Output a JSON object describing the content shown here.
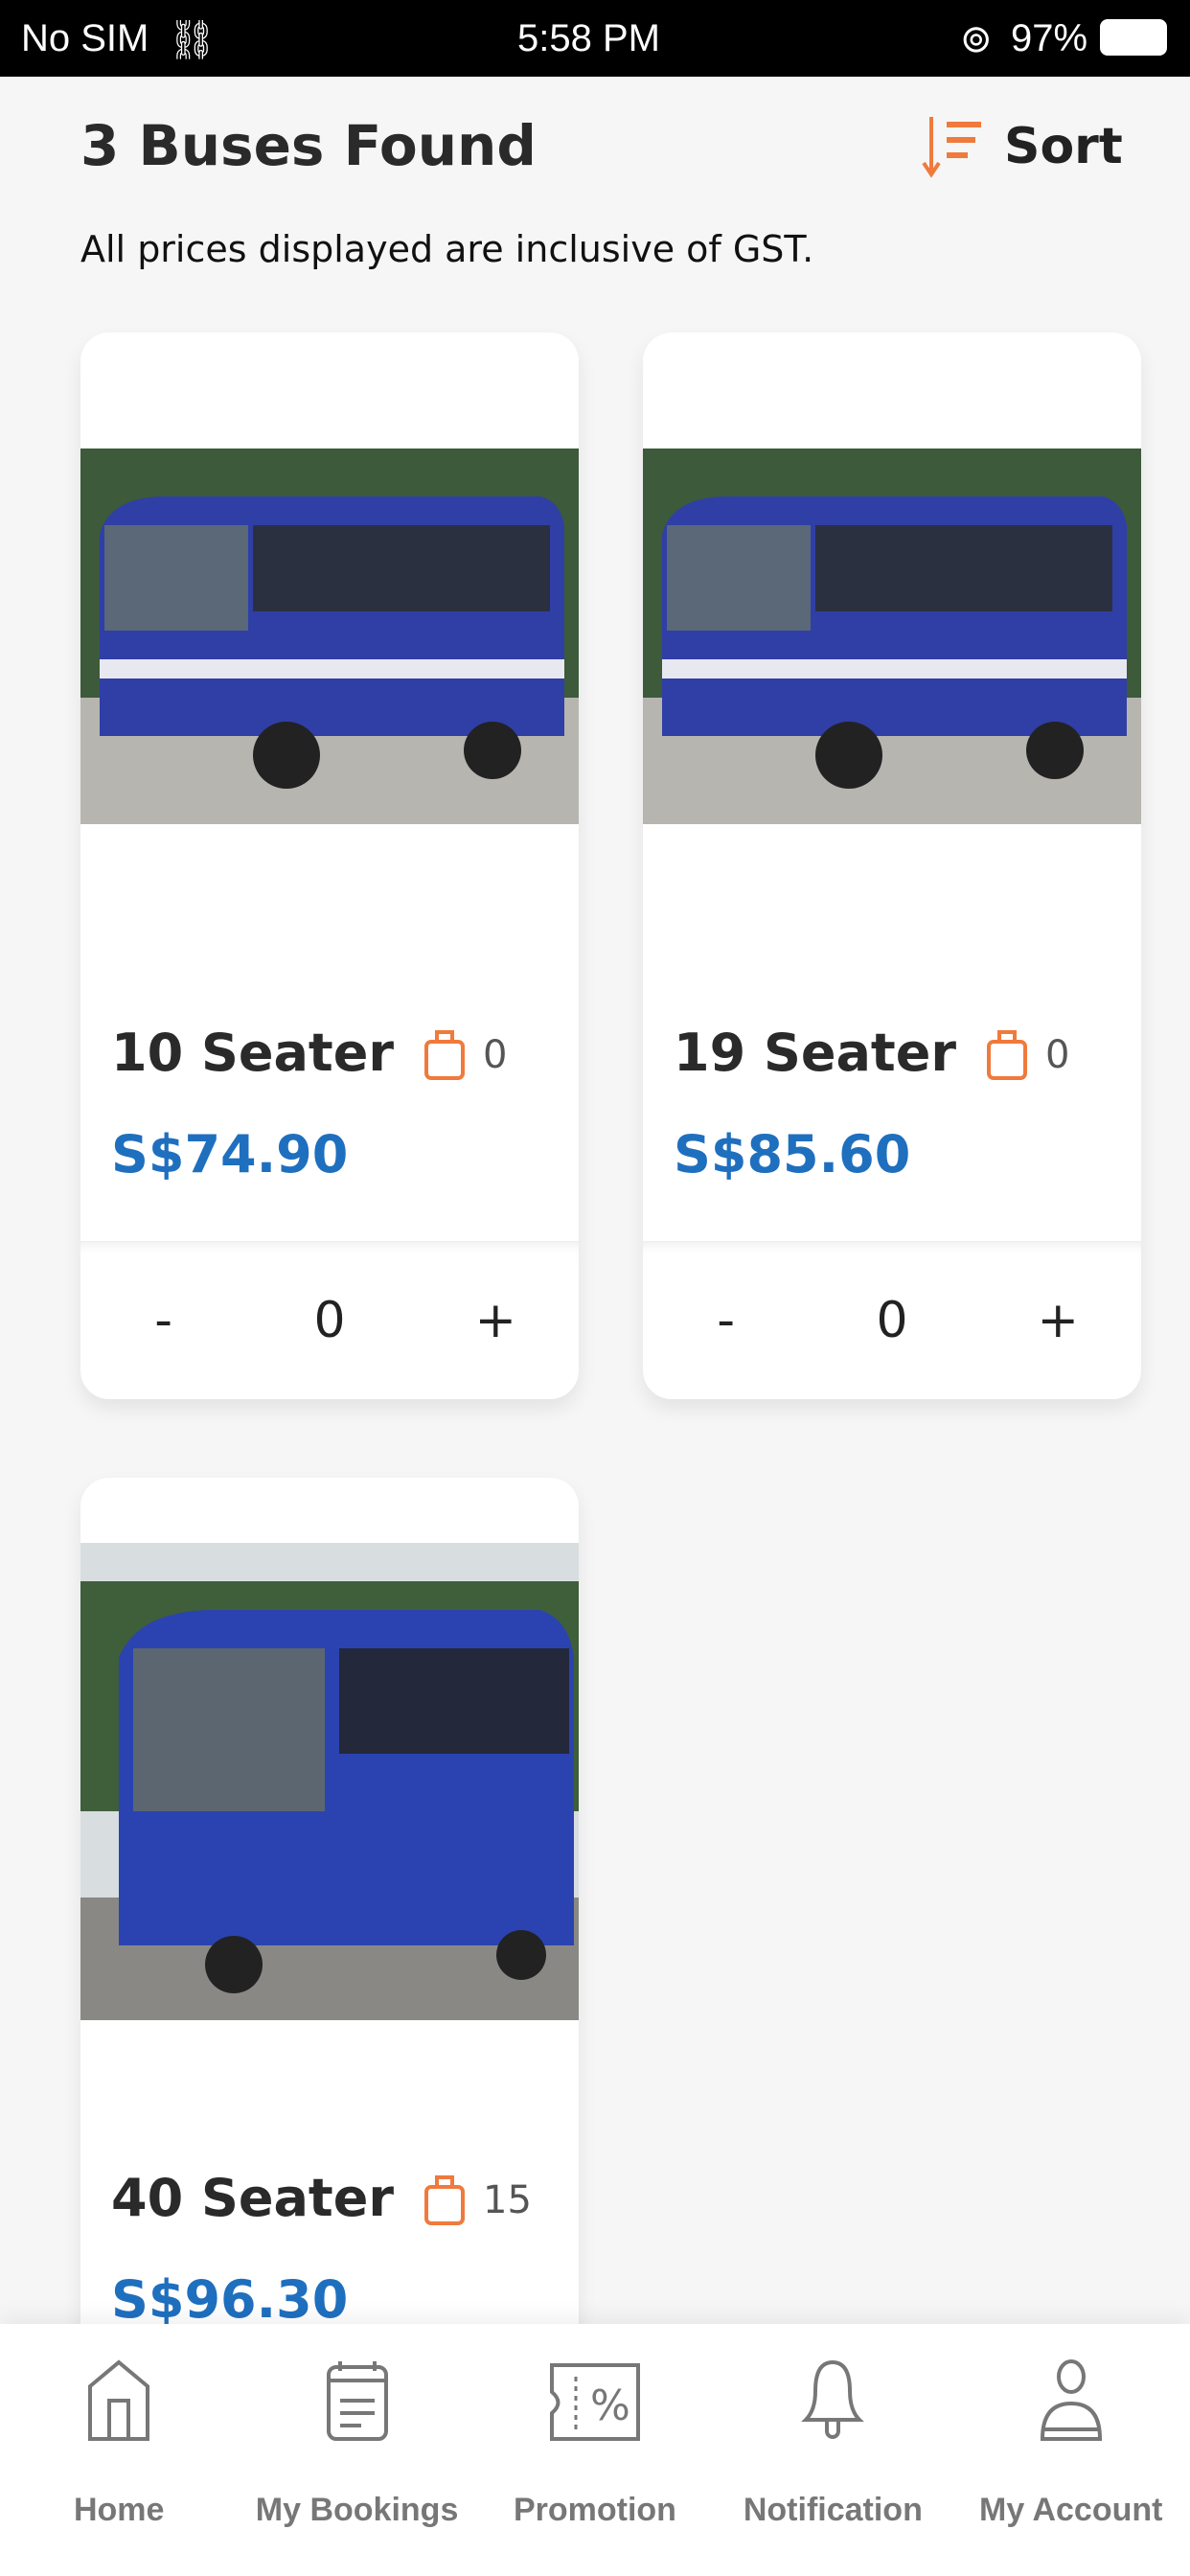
{
  "status_bar": {
    "carrier": "No SIM",
    "time": "5:58 PM",
    "battery": "97%"
  },
  "header": {
    "title": "3 Buses Found",
    "sort_label": "Sort",
    "note": "All prices displayed are inclusive of GST."
  },
  "accent_color": "#f07a3c",
  "price_color": "#1f6fbf",
  "buses": [
    {
      "name": "10 Seater",
      "luggage": "0",
      "price": "S$74.90",
      "qty": {
        "minus": "-",
        "value": "0",
        "plus": "+"
      }
    },
    {
      "name": "19 Seater",
      "luggage": "0",
      "price": "S$85.60",
      "qty": {
        "minus": "-",
        "value": "0",
        "plus": "+"
      }
    },
    {
      "name": "40 Seater",
      "luggage": "15",
      "price": "S$96.30"
    }
  ],
  "nav": [
    {
      "label": "Home",
      "icon": "home-icon"
    },
    {
      "label": "My Bookings",
      "icon": "bookings-icon"
    },
    {
      "label": "Promotion",
      "icon": "promotion-icon"
    },
    {
      "label": "Notification",
      "icon": "bell-icon"
    },
    {
      "label": "My Account",
      "icon": "account-icon"
    }
  ]
}
